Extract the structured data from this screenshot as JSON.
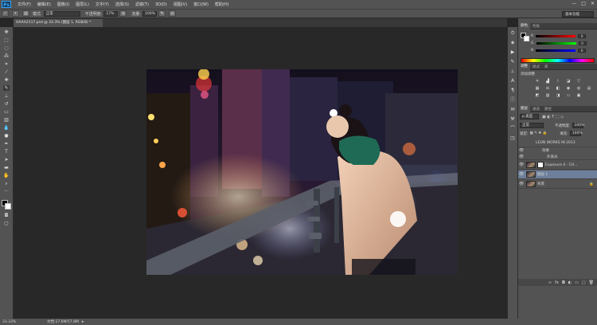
{
  "app": {
    "logo": "Ps",
    "menu": [
      "文件(F)",
      "编辑(E)",
      "图像(I)",
      "图层(L)",
      "文字(Y)",
      "选择(S)",
      "滤镜(T)",
      "3D(D)",
      "视图(V)",
      "窗口(W)",
      "帮助(H)"
    ],
    "window_controls": [
      "—",
      "□",
      "✕"
    ]
  },
  "options_bar": {
    "mode_label": "模式:",
    "mode_value": "正常",
    "opacity_label": "不透明度:",
    "opacity_value": "17%",
    "flow_label": "流量:",
    "flow_value": "100%",
    "workspace": "基本功能"
  },
  "document": {
    "tab_title": "HAAA2117.psd @ 33.3% (图层 1, RGB/8) *"
  },
  "status_bar": {
    "zoom": "33.33%",
    "doc_info": "文档:17.6M/57.8M"
  },
  "color_panel": {
    "tabs": [
      "颜色",
      "色板"
    ],
    "sliders": [
      {
        "label": "R",
        "value": "0",
        "color": "#e03030"
      },
      {
        "label": "G",
        "value": "0",
        "color": "#30c040"
      },
      {
        "label": "B",
        "value": "0",
        "color": "#3050e0"
      }
    ]
  },
  "adjustments_panel": {
    "tabs": [
      "调整",
      "样式",
      "库"
    ],
    "title": "添加调整"
  },
  "layers_panel": {
    "tabs": [
      "图层",
      "通道",
      "路径"
    ],
    "kind_label": "ρ 类型",
    "blend_mode": "正常",
    "opacity_label": "不透明度:",
    "opacity_value": "100%",
    "lock_label": "锁定:",
    "fill_label": "填充:",
    "fill_value": "100%",
    "layers": [
      {
        "name": "LEON WORKS IN 2013",
        "type": "text"
      },
      {
        "name": "效果",
        "type": "effects"
      },
      {
        "name": "外发光",
        "type": "effect"
      },
      {
        "name": "Exposure 4 - CH...",
        "type": "adjustment"
      },
      {
        "name": "图层 1",
        "type": "pixel",
        "selected": true
      },
      {
        "name": "背景",
        "type": "background"
      }
    ]
  },
  "colors": {
    "ui_dark": "#535353",
    "canvas_bg": "#282828",
    "selected_layer": "#6d7f9a"
  }
}
